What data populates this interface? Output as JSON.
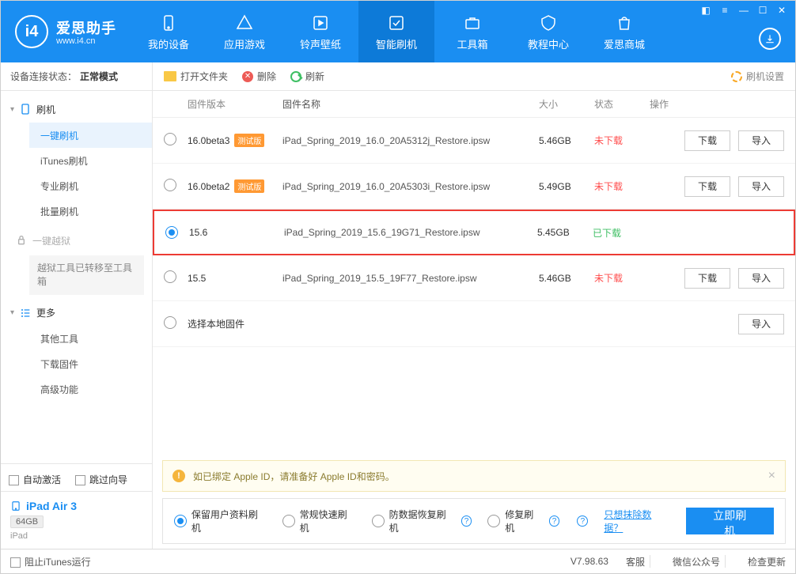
{
  "header": {
    "app_name": "爱思助手",
    "app_url": "www.i4.cn",
    "nav": [
      {
        "label": "我的设备"
      },
      {
        "label": "应用游戏"
      },
      {
        "label": "铃声壁纸"
      },
      {
        "label": "智能刷机"
      },
      {
        "label": "工具箱"
      },
      {
        "label": "教程中心"
      },
      {
        "label": "爱思商城"
      }
    ]
  },
  "sidebar": {
    "conn_label": "设备连接状态：",
    "conn_value": "正常模式",
    "groups": [
      {
        "title": "刷机",
        "items": [
          {
            "label": "一键刷机",
            "active": true
          },
          {
            "label": "iTunes刷机"
          },
          {
            "label": "专业刷机"
          },
          {
            "label": "批量刷机"
          }
        ]
      },
      {
        "title": "一键越狱",
        "disabled": true,
        "note": "越狱工具已转移至工具箱"
      },
      {
        "title": "更多",
        "items": [
          {
            "label": "其他工具"
          },
          {
            "label": "下载固件"
          },
          {
            "label": "高级功能"
          }
        ]
      }
    ],
    "auto_activate": "自动激活",
    "skip_guide": "跳过向导",
    "device_name": "iPad Air 3",
    "device_capacity": "64GB",
    "device_type": "iPad"
  },
  "toolbar": {
    "open_folder": "打开文件夹",
    "delete": "删除",
    "refresh": "刷新",
    "settings": "刷机设置"
  },
  "columns": {
    "version": "固件版本",
    "name": "固件名称",
    "size": "大小",
    "status": "状态",
    "action": "操作"
  },
  "firmware": [
    {
      "selected": false,
      "version": "16.0beta3",
      "beta": "测试版",
      "name": "iPad_Spring_2019_16.0_20A5312j_Restore.ipsw",
      "size": "5.46GB",
      "status": "未下载",
      "status_cls": "no",
      "show_actions": true
    },
    {
      "selected": false,
      "version": "16.0beta2",
      "beta": "测试版",
      "name": "iPad_Spring_2019_16.0_20A5303i_Restore.ipsw",
      "size": "5.49GB",
      "status": "未下载",
      "status_cls": "no",
      "show_actions": true
    },
    {
      "selected": true,
      "version": "15.6",
      "name": "iPad_Spring_2019_15.6_19G71_Restore.ipsw",
      "size": "5.45GB",
      "status": "已下载",
      "status_cls": "yes",
      "show_actions": false,
      "highlight": true
    },
    {
      "selected": false,
      "version": "15.5",
      "name": "iPad_Spring_2019_15.5_19F77_Restore.ipsw",
      "size": "5.46GB",
      "status": "未下载",
      "status_cls": "no",
      "show_actions": true
    }
  ],
  "local_row": {
    "label": "选择本地固件",
    "import": "导入"
  },
  "buttons": {
    "download": "下载",
    "import": "导入"
  },
  "alert": "如已绑定 Apple ID，请准备好 Apple ID和密码。",
  "flash_options": [
    {
      "label": "保留用户资料刷机",
      "selected": true,
      "help": false
    },
    {
      "label": "常规快速刷机",
      "help": false
    },
    {
      "label": "防数据恢复刷机",
      "help": true
    },
    {
      "label": "修复刷机",
      "help": true
    }
  ],
  "erase_link": "只想抹除数据？",
  "flash_now": "立即刷机",
  "footer": {
    "block_itunes": "阻止iTunes运行",
    "version": "V7.98.63",
    "service": "客服",
    "wechat": "微信公众号",
    "update": "检查更新"
  }
}
